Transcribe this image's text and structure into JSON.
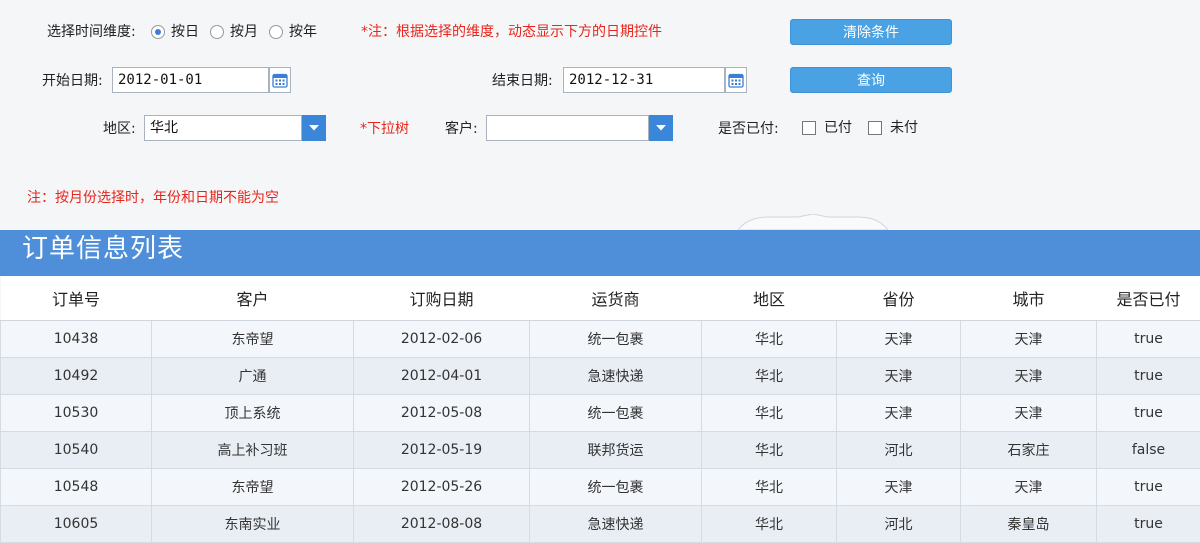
{
  "filters": {
    "dimension_label": "选择时间维度:",
    "dimension_options": [
      {
        "label": "按日",
        "selected": true
      },
      {
        "label": "按月",
        "selected": false
      },
      {
        "label": "按年",
        "selected": false
      }
    ],
    "dimension_note": "*注：根据选择的维度，动态显示下方的日期控件",
    "clear_button": "清除条件",
    "start_date_label": "开始日期:",
    "start_date_value": "2012-01-01",
    "end_date_label": "结束日期:",
    "end_date_value": "2012-12-31",
    "query_button": "查询",
    "region_label": "地区:",
    "region_value": "华北",
    "region_note": "*下拉树",
    "customer_label": "客户:",
    "customer_value": "",
    "paid_label": "是否已付:",
    "paid_options": [
      {
        "label": "已付",
        "checked": false
      },
      {
        "label": "未付",
        "checked": false
      }
    ],
    "month_note": "注：按月份选择时，年份和日期不能为空"
  },
  "list": {
    "title": "订单信息列表",
    "columns": [
      "订单号",
      "客户",
      "订购日期",
      "运货商",
      "地区",
      "省份",
      "城市",
      "是否已付"
    ],
    "rows": [
      [
        "10438",
        "东帝望",
        "2012-02-06",
        "统一包裹",
        "华北",
        "天津",
        "天津",
        "true"
      ],
      [
        "10492",
        "广通",
        "2012-04-01",
        "急速快递",
        "华北",
        "天津",
        "天津",
        "true"
      ],
      [
        "10530",
        "顶上系统",
        "2012-05-08",
        "统一包裹",
        "华北",
        "天津",
        "天津",
        "true"
      ],
      [
        "10540",
        "高上补习班",
        "2012-05-19",
        "联邦货运",
        "华北",
        "河北",
        "石家庄",
        "false"
      ],
      [
        "10548",
        "东帝望",
        "2012-05-26",
        "统一包裹",
        "华北",
        "天津",
        "天津",
        "true"
      ],
      [
        "10605",
        "东南实业",
        "2012-08-08",
        "急速快递",
        "华北",
        "河北",
        "秦皇岛",
        "true"
      ]
    ]
  },
  "colors": {
    "accent": "#4f8ed8",
    "button": "#4aa1e4",
    "note_red": "#e8261c"
  }
}
